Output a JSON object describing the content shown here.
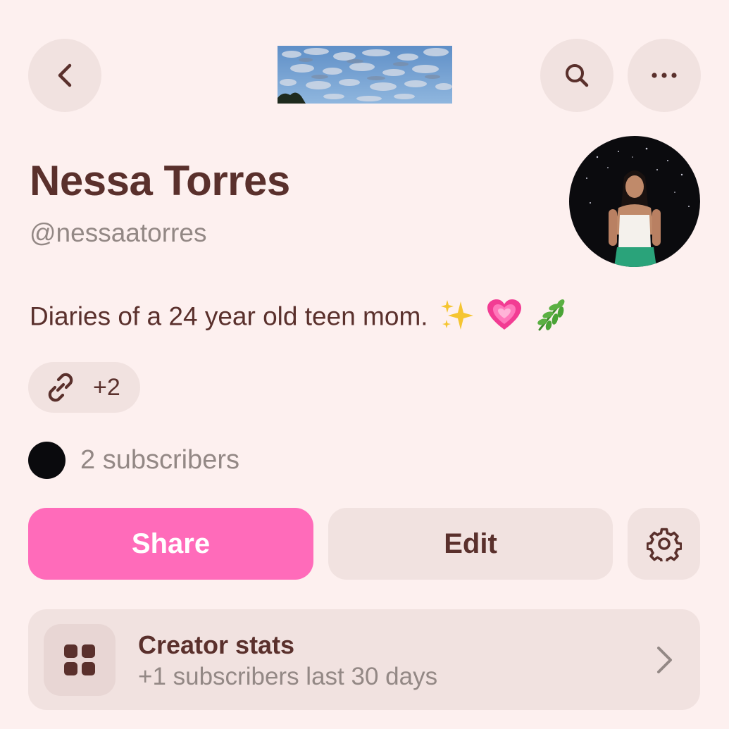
{
  "topbar": {
    "back_icon": "chevron-left-icon",
    "search_icon": "search-icon",
    "more_icon": "ellipsis-icon"
  },
  "profile": {
    "name": "Nessa Torres",
    "handle": "@nessaatorres",
    "bio": "Diaries of a 24 year old teen mom.",
    "bio_emojis": [
      "sparkles",
      "growing-heart",
      "herb"
    ],
    "links_count": "+2",
    "subscribers": "2 subscribers"
  },
  "actions": {
    "share_label": "Share",
    "edit_label": "Edit",
    "settings_icon": "gear-icon"
  },
  "creator_stats": {
    "title": "Creator stats",
    "subtitle": "+1 subscribers last 30 days"
  },
  "colors": {
    "background": "#fdf0ef",
    "text": "#5a302c",
    "muted": "#938885",
    "accent": "#ff6bba",
    "surface": "#f1e2e0"
  }
}
